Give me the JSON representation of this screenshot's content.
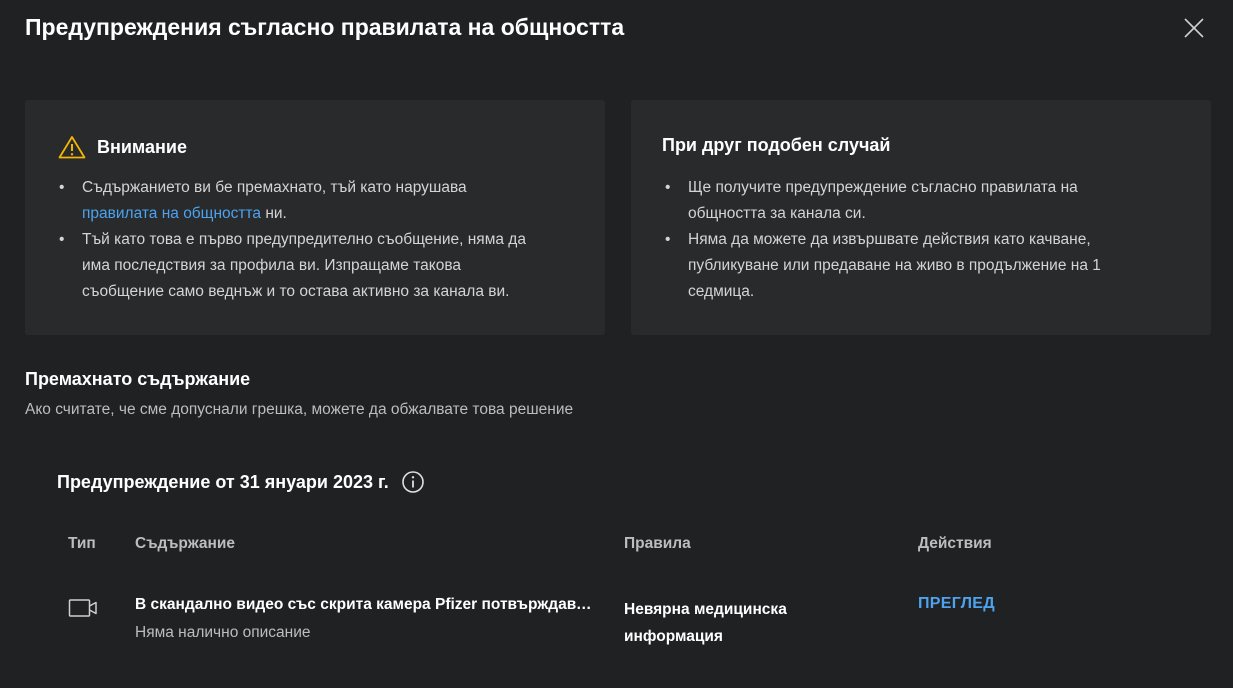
{
  "dialog": {
    "title": "Предупреждения съгласно правилата на общността",
    "close_icon": "close-icon"
  },
  "warning_card": {
    "icon": "warning-triangle-icon",
    "icon_color": "#f2b705",
    "heading": "Внимание",
    "bullet1_before": "Съдържанието ви бе премахнато, тъй като нарушава",
    "bullet1_link": "правилата на общността",
    "bullet1_after": " ни.",
    "bullet2_line1": "Тъй като това е първо предупредително съобщение, няма да",
    "bullet2_line2": "има последствия за профила ви. Изпращаме такова",
    "bullet2_line3": "съобщение само веднъж и то остава активно за канала ви."
  },
  "next_time_card": {
    "heading": "При друг подобен случай",
    "bullet1_line1": "Ще получите предупреждение съгласно правилата на",
    "bullet1_line2": "общността за канала си.",
    "bullet2_line1": "Няма да можете да извършвате действия като качване,",
    "bullet2_line2": "публикуване или предаване на живо в продължение на 1",
    "bullet2_line3": "седмица."
  },
  "removed_content": {
    "title": "Премахнато съдържание",
    "subtitle": "Ако считате, че сме допуснали грешка, можете да обжалвате това решение"
  },
  "strike": {
    "heading": "Предупреждение от 31 януари 2023 г.",
    "info_icon": "info-icon",
    "columns": {
      "type": "Тип",
      "content": "Съдържание",
      "policy": "Правила",
      "actions": "Действия"
    },
    "row": {
      "type_icon": "video-camera-icon",
      "content_title": "В скандално видео със скрита камера Pfizer потвърждава...",
      "content_desc": "Няма налично описание",
      "policy_line1": "Невярна медицинска",
      "policy_line2": "информация",
      "action_label": "ПРЕГЛЕД"
    }
  },
  "colors": {
    "background": "#1f2122",
    "card": "#282a2c",
    "link": "#4da3ef",
    "warning": "#f2b705"
  }
}
